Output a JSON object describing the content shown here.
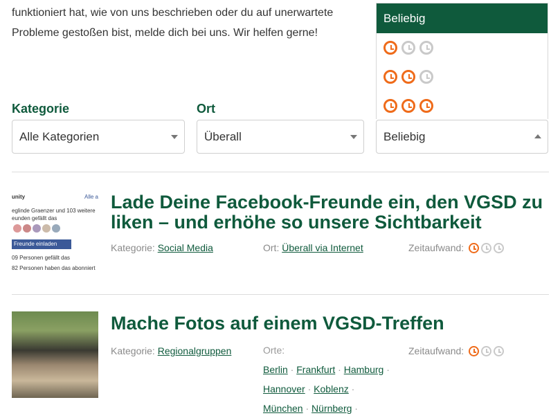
{
  "intro_text": "funktioniert hat, wie von uns beschrieben oder du auf unerwartete Probleme gestoßen bist, melde dich bei uns. Wir helfen gerne!",
  "filters": {
    "kategorie_label": "Kategorie",
    "kategorie_value": "Alle Kategorien",
    "ort_label": "Ort",
    "ort_value": "Überall",
    "zeit_value": "Beliebig"
  },
  "dropdown": {
    "selected": "Beliebig",
    "options": [
      {
        "level": 1,
        "of": 3
      },
      {
        "level": 2,
        "of": 3
      },
      {
        "level": 3,
        "of": 3
      }
    ]
  },
  "items": [
    {
      "title": "Lade Deine Facebook-Freunde ein, den VGSD zu liken – und erhöhe so unsere Sichtbarkeit",
      "kategorie_prefix": "Kategorie:",
      "kategorie": "Social Media",
      "ort_prefix": "Ort:",
      "ort": "Überall via Internet",
      "zeit_prefix": "Zeitaufwand:",
      "zeit_level": 1,
      "thumb_text": {
        "header": "unity",
        "link": "Alle a",
        "line1": "eglinde Graenzer und 103 weitere",
        "line2": "eunden gefällt das",
        "button": "Freunde einladen",
        "line3": "09 Personen gefällt das",
        "line4": "82 Personen haben das abonniert"
      }
    },
    {
      "title": "Mache Fotos auf einem VGSD-Treffen",
      "kategorie_prefix": "Kategorie:",
      "kategorie": "Regionalgruppen",
      "orte_prefix": "Orte:",
      "orte": [
        "Berlin",
        "Frankfurt",
        "Hamburg",
        "Hannover",
        "Koblenz",
        "München",
        "Nürnberg"
      ],
      "zeit_prefix": "Zeitaufwand:",
      "zeit_level": 1
    }
  ]
}
